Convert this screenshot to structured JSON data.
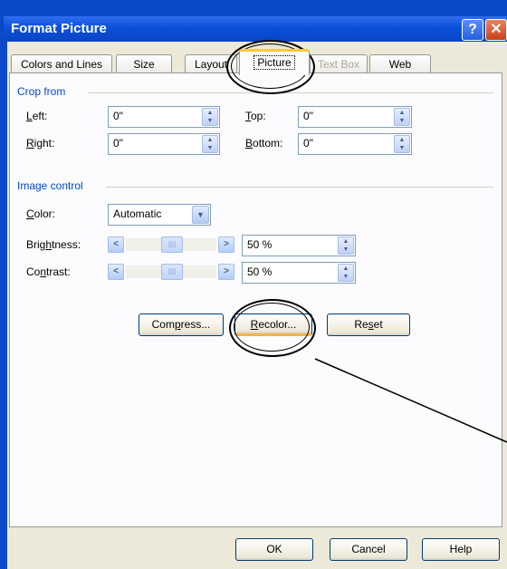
{
  "window": {
    "title": "Format Picture",
    "help_glyph": "?",
    "close_glyph": "✕"
  },
  "tabs": [
    {
      "label": "Colors and Lines",
      "state": "normal"
    },
    {
      "label": "Size",
      "state": "normal"
    },
    {
      "label": "Layout",
      "state": "normal"
    },
    {
      "label": "Picture",
      "state": "active"
    },
    {
      "label": "Text Box",
      "state": "disabled"
    },
    {
      "label": "Web",
      "state": "normal"
    }
  ],
  "crop": {
    "title": "Crop from",
    "left": {
      "label_u": "L",
      "label_rest": "eft:",
      "value": "0\""
    },
    "right": {
      "label_u": "R",
      "label_rest": "ight:",
      "value": "0\""
    },
    "top": {
      "label_u": "T",
      "label_rest": "op:",
      "value": "0\""
    },
    "bottom": {
      "label_u": "B",
      "label_rest": "ottom:",
      "value": "0\""
    }
  },
  "image_control": {
    "title": "Image control",
    "color": {
      "label_u": "C",
      "label_rest": "olor:",
      "value": "Automatic"
    },
    "brightness": {
      "label_pre": "Brig",
      "label_u": "h",
      "label_rest": "tness:",
      "value": "50 %",
      "level_percent": 50
    },
    "contrast": {
      "label_pre": "Co",
      "label_u": "n",
      "label_rest": "trast:",
      "value": "50 %",
      "level_percent": 50
    }
  },
  "buttons": {
    "compress": {
      "pre": "Com",
      "u": "p",
      "rest": "ress..."
    },
    "recolor": {
      "pre": "",
      "u": "R",
      "rest": "ecolor..."
    },
    "reset": {
      "pre": "Re",
      "u": "s",
      "rest": "et"
    },
    "ok": "OK",
    "cancel": "Cancel",
    "help": "Help"
  },
  "icons": {
    "spin_up": "▲",
    "spin_down": "▼",
    "drop": "▼",
    "left_arrow": "<",
    "right_arrow": ">",
    "grip": "||||"
  }
}
